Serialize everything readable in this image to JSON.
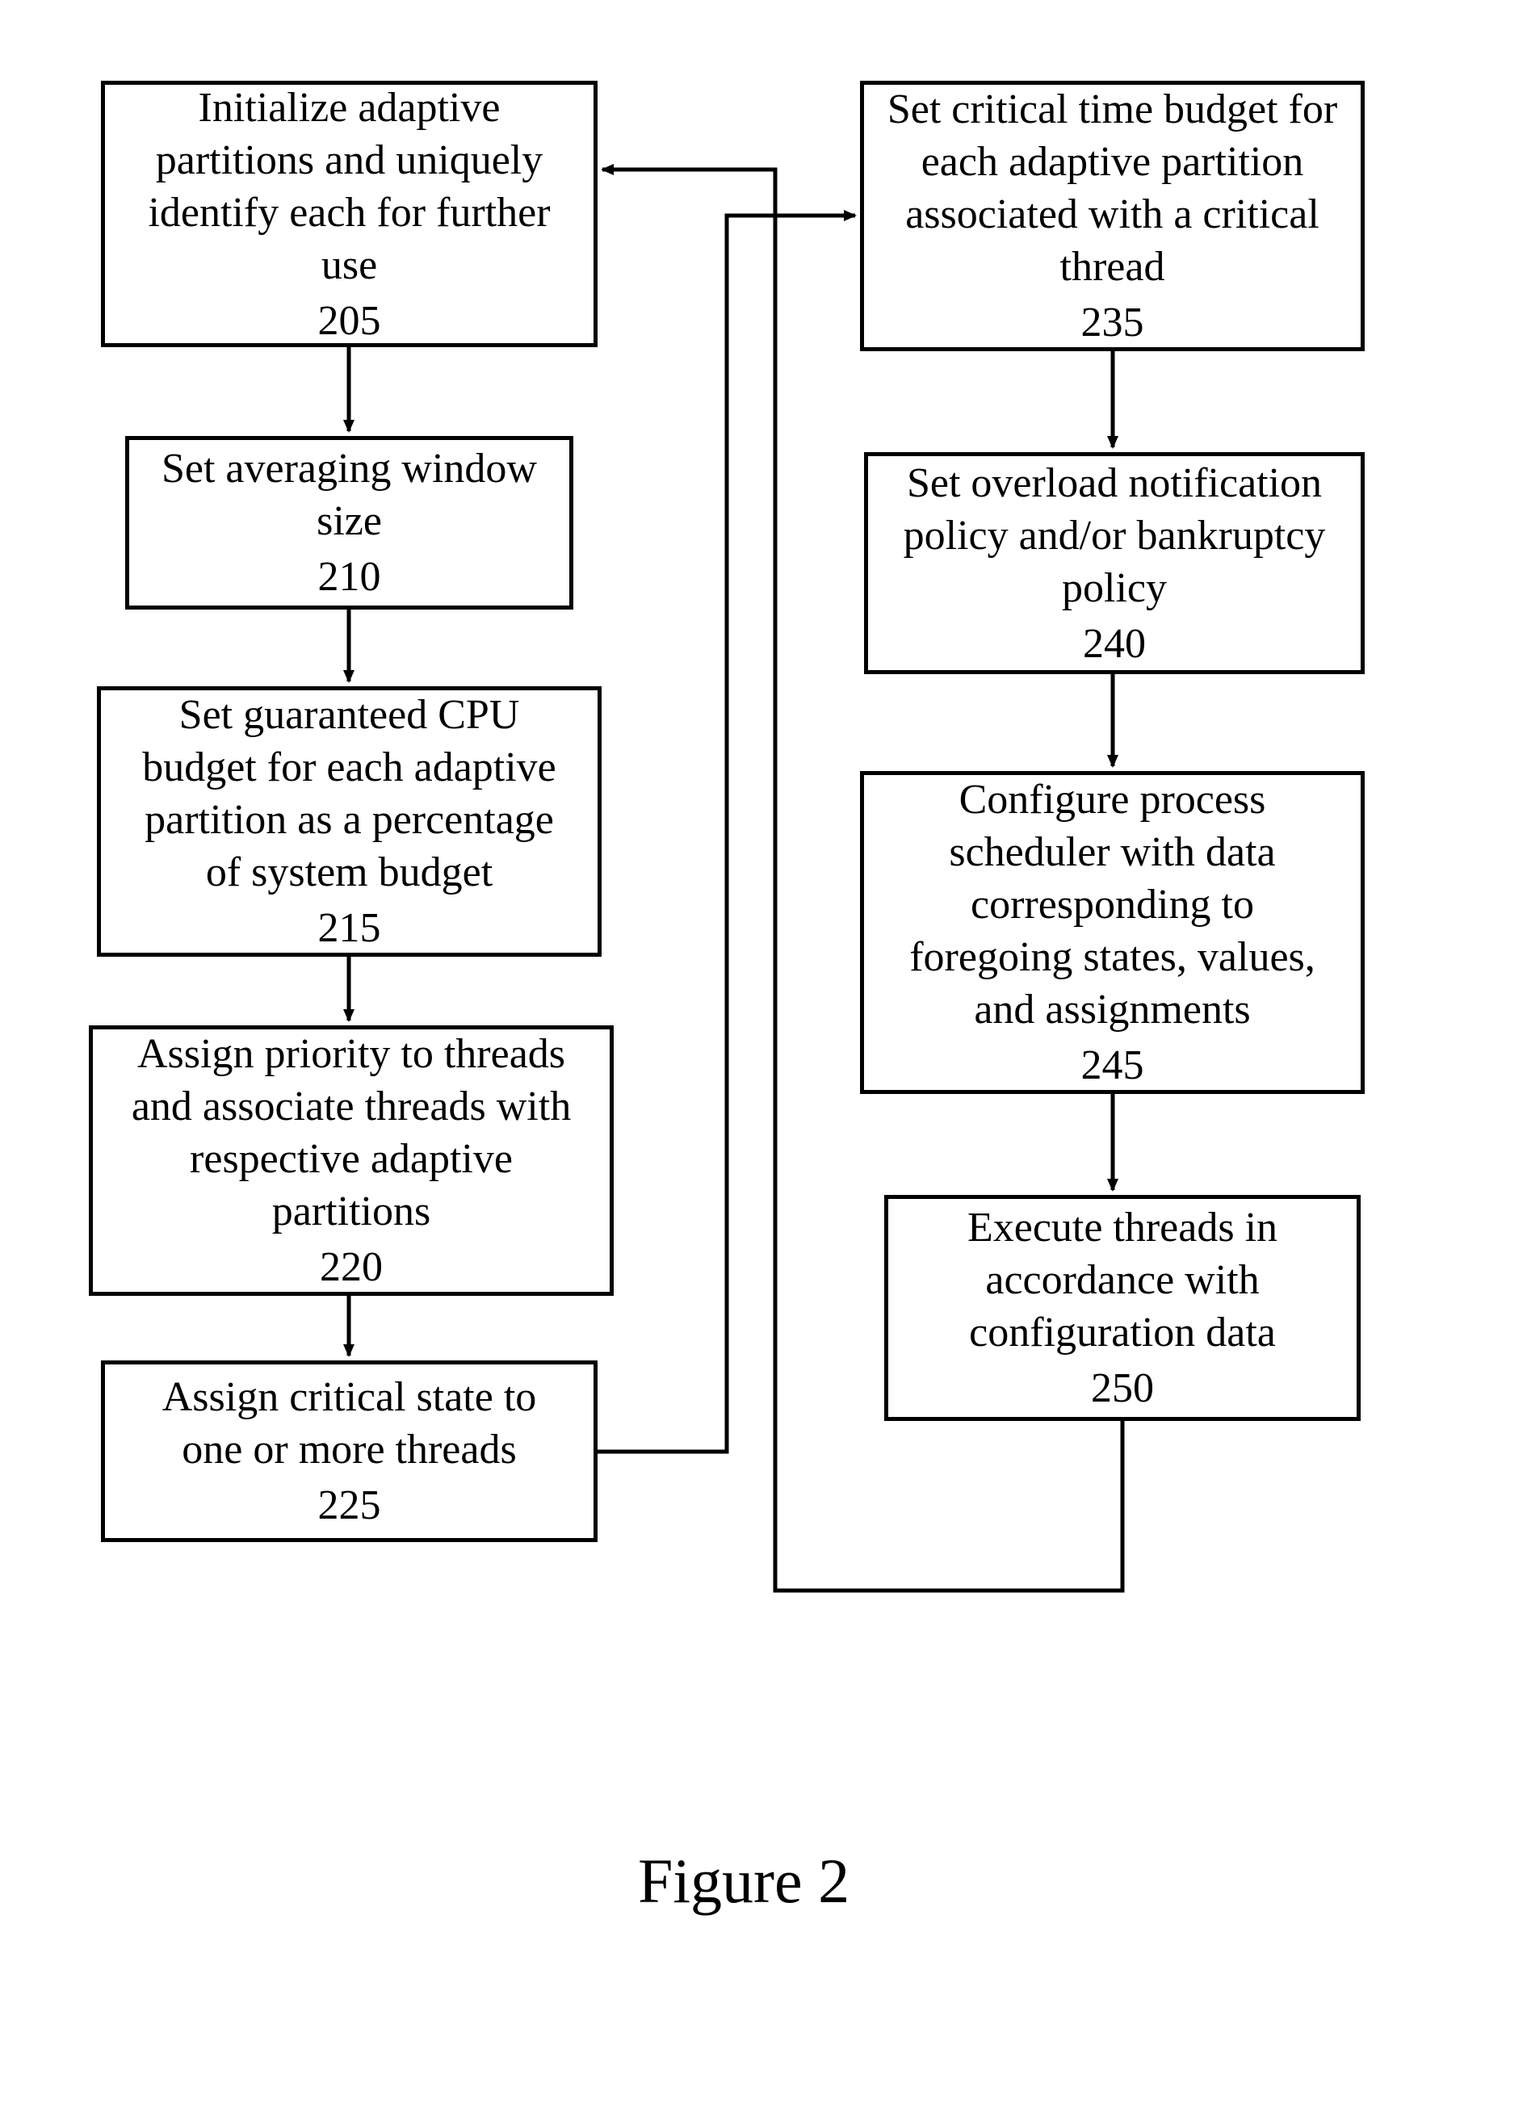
{
  "caption": "Figure 2",
  "boxes": {
    "b205": {
      "text": "Initialize adaptive partitions and uniquely identify each for further use",
      "ref": "205"
    },
    "b210": {
      "text": "Set averaging window size",
      "ref": "210"
    },
    "b215": {
      "text": "Set guaranteed CPU budget for each adaptive partition as a percentage of system budget",
      "ref": "215"
    },
    "b220": {
      "text": "Assign priority to threads and associate threads with respective adaptive partitions",
      "ref": "220"
    },
    "b225": {
      "text": "Assign critical state to one or more threads",
      "ref": "225"
    },
    "b235": {
      "text": "Set critical time budget for each adaptive partition associated with a critical thread",
      "ref": "235"
    },
    "b240": {
      "text": "Set overload notification policy and/or bankruptcy policy",
      "ref": "240"
    },
    "b245": {
      "text": "Configure process scheduler with data corresponding to foregoing states, values, and assignments",
      "ref": "245"
    },
    "b250": {
      "text": "Execute threads in accordance with configuration data",
      "ref": "250"
    }
  }
}
